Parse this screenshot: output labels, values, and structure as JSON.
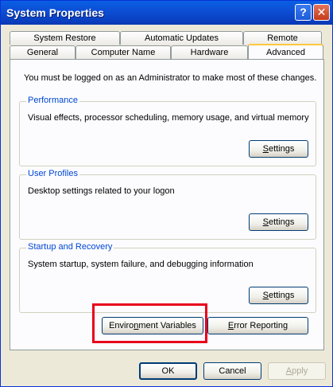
{
  "window": {
    "title": "System Properties",
    "help_glyph": "?",
    "close_glyph": "✕"
  },
  "tabs_back": [
    {
      "label": "System Restore"
    },
    {
      "label": "Automatic Updates"
    },
    {
      "label": "Remote"
    }
  ],
  "tabs_front": [
    {
      "label": "General"
    },
    {
      "label": "Computer Name"
    },
    {
      "label": "Hardware"
    },
    {
      "label": "Advanced",
      "active": true
    }
  ],
  "intro": "You must be logged on as an Administrator to make most of these changes.",
  "groups": [
    {
      "title": "Performance",
      "description": "Visual effects, processor scheduling, memory usage, and virtual memory",
      "button_first": "S",
      "button_rest": "ettings"
    },
    {
      "title": "User Profiles",
      "description": "Desktop settings related to your logon",
      "button_first": "S",
      "button_rest": "ettings"
    },
    {
      "title": "Startup and Recovery",
      "description": "System startup, system failure, and debugging information",
      "button_first": "S",
      "button_rest": "ettings"
    }
  ],
  "buttons": {
    "env_a": "Enviro",
    "env_u": "n",
    "env_b": "ment Variables",
    "err_u": "E",
    "err_b": "rror Reporting",
    "ok": "OK",
    "cancel": "Cancel",
    "apply_u": "A",
    "apply_b": "pply"
  },
  "colors": {
    "title_bar": "#0C4FD6",
    "highlight": "#E8001C",
    "group_title": "#0046D5"
  }
}
